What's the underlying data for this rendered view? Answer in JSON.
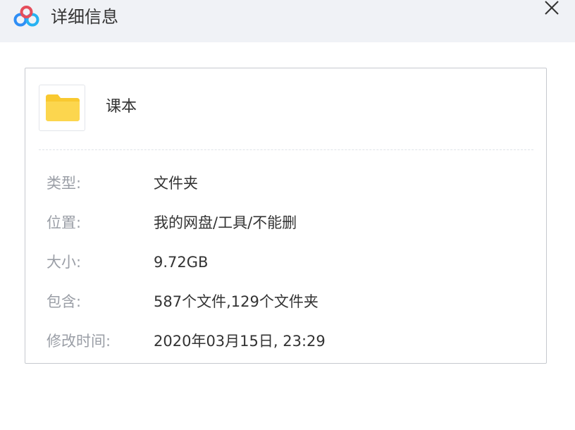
{
  "window": {
    "title": "详细信息",
    "logo_icon": "baidu-netdisk-cloud-icon",
    "close_icon": "close-icon"
  },
  "colors": {
    "titlebar_bg": "#f0f2f6",
    "folder_fill": "#fcd34d",
    "label_text": "#9a9ea6",
    "value_text": "#333333"
  },
  "file": {
    "name": "课本",
    "icon": "folder-icon"
  },
  "details": [
    {
      "label": "类型:",
      "value": "文件夹"
    },
    {
      "label": "位置:",
      "value": "我的网盘/工具/不能删"
    },
    {
      "label": "大小:",
      "value": "9.72GB"
    },
    {
      "label": "包含:",
      "value": "587个文件,129个文件夹"
    },
    {
      "label": "修改时间:",
      "value": "2020年03月15日, 23:29"
    }
  ]
}
